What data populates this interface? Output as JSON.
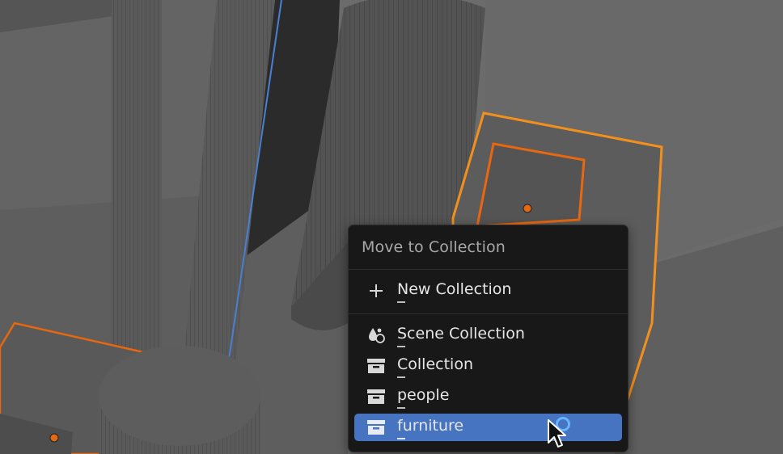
{
  "menu": {
    "title": "Move to Collection",
    "items": [
      {
        "label": "New Collection",
        "icon": "plus-icon",
        "selected": false
      },
      {
        "label": "Scene Collection",
        "icon": "scene-collection-icon",
        "selected": false
      },
      {
        "label": "Collection",
        "icon": "collection-box-icon",
        "selected": false
      },
      {
        "label": "people",
        "icon": "collection-box-icon",
        "selected": false
      },
      {
        "label": "furniture",
        "icon": "collection-box-icon",
        "selected": true
      }
    ]
  },
  "colors": {
    "menu_background": "#181818",
    "selection_highlight": "#4774c0",
    "selected_object_outline": "#f3901d",
    "active_object_outline": "#e8670f",
    "viewport_background": "#6a6a6a"
  }
}
